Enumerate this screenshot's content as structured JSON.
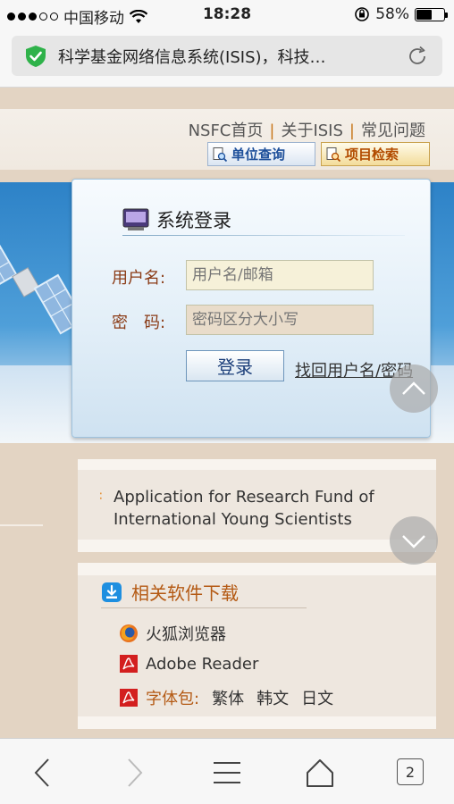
{
  "status_bar": {
    "carrier": "中国移动",
    "time": "18:28",
    "battery_text": "58%",
    "battery_level": 0.58
  },
  "browser": {
    "url_text": "科学基金网络信息系统(ISIS)，科技…",
    "tabs_count": "2"
  },
  "header": {
    "nav": [
      "NSFC首页",
      "关于ISIS",
      "常见问题"
    ],
    "unit_query_label": "单位查询",
    "project_search_label": "项目检索"
  },
  "login": {
    "title": "系统登录",
    "username_label": "用户名:",
    "username_placeholder": "用户名/邮箱",
    "password_label": "密　码:",
    "password_placeholder": "密码区分大小写",
    "login_button": "登录",
    "forgot_link": "找回用户名/密码"
  },
  "news": {
    "title_line1": "Application for Research Fund of",
    "title_line2": "International Young Scientists"
  },
  "downloads": {
    "title": "相关软件下载",
    "items": [
      "火狐浏览器",
      "Adobe Reader"
    ],
    "fontpack_label": "字体包:",
    "fontpack_options": [
      "繁体",
      "韩文",
      "日文"
    ]
  },
  "colors": {
    "accent_orange": "#b45a14",
    "hero_blue": "#2d82c7",
    "background_beige": "#e2d2c2"
  }
}
